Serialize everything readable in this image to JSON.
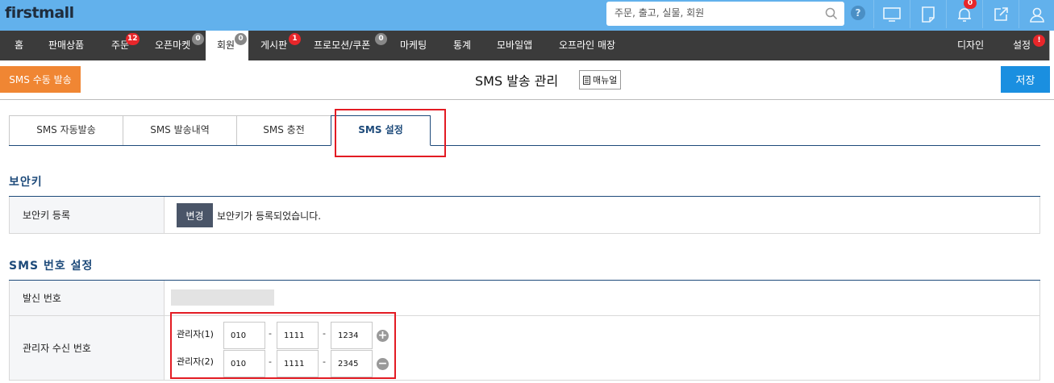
{
  "app": {
    "logo": "firstmall"
  },
  "search": {
    "placeholder": "주문, 출고, 실물, 회원"
  },
  "topbar": {
    "help": "?",
    "notification_count": "0"
  },
  "nav": {
    "items": [
      {
        "label": "홈"
      },
      {
        "label": "판매상품"
      },
      {
        "label": "주문",
        "badge": "12"
      },
      {
        "label": "오픈마켓",
        "badge": "0"
      },
      {
        "label": "회원",
        "badge": "0"
      },
      {
        "label": "게시판",
        "badge": "1"
      },
      {
        "label": "프로모션/쿠폰",
        "badge": "0"
      },
      {
        "label": "마케팅"
      },
      {
        "label": "통계"
      },
      {
        "label": "모바일앱"
      },
      {
        "label": "오프라인 매장"
      },
      {
        "label": "디자인"
      },
      {
        "label": "설정",
        "badge": "!"
      }
    ]
  },
  "header": {
    "sms_manual_send": "SMS 수동 발송",
    "title": "SMS 발송 관리",
    "manual": "매뉴얼",
    "save": "저장"
  },
  "tabs": [
    {
      "label": "SMS 자동발송"
    },
    {
      "label": "SMS 발송내역"
    },
    {
      "label": "SMS 충전"
    },
    {
      "label": "SMS 설정"
    }
  ],
  "security": {
    "title": "보안키",
    "row_label": "보안키 등록",
    "change_button": "변경",
    "status": "보안키가 등록되었습니다."
  },
  "sms_number": {
    "title": "SMS 번호 설정",
    "sender_label": "발신 번호",
    "admin_label": "관리자 수신 번호",
    "dash": "-",
    "admins": [
      {
        "label": "관리자(1)",
        "p1": "010",
        "p2": "1111",
        "p3": "1234"
      },
      {
        "label": "관리자(2)",
        "p1": "010",
        "p2": "1111",
        "p3": "2345"
      }
    ]
  },
  "colors": {
    "topbar": "#62b1ec",
    "nav": "#3b3b3b",
    "accent_orange": "#f08633",
    "accent_blue": "#1a8fe0",
    "section_title": "#1d4a7a",
    "highlight_red": "#e31b23",
    "badge_red": "#e8262a"
  },
  "icons": [
    "search-icon",
    "help-icon",
    "monitor-icon",
    "memo-icon",
    "bell-icon",
    "external-link-icon",
    "user-icon",
    "document-icon",
    "plus-circle-icon",
    "minus-circle-icon"
  ]
}
